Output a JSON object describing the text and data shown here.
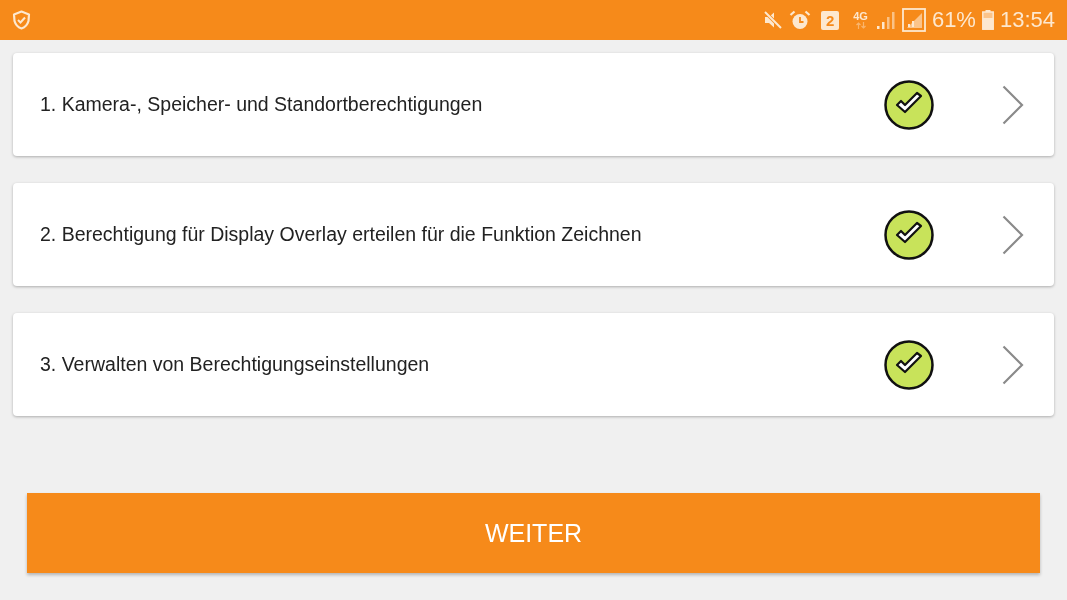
{
  "status_bar": {
    "sim_slot": "2",
    "network": "4G",
    "battery": "61%",
    "time": "13:54"
  },
  "steps": [
    {
      "label": "1. Kamera-, Speicher- und Standortberechtigungen",
      "completed": true
    },
    {
      "label": "2. Berechtigung für Display Overlay erteilen für die Funktion Zeichnen",
      "completed": true
    },
    {
      "label": "3. Verwalten von Berechtigungseinstellungen",
      "completed": true
    }
  ],
  "button": {
    "label": "WEITER"
  }
}
